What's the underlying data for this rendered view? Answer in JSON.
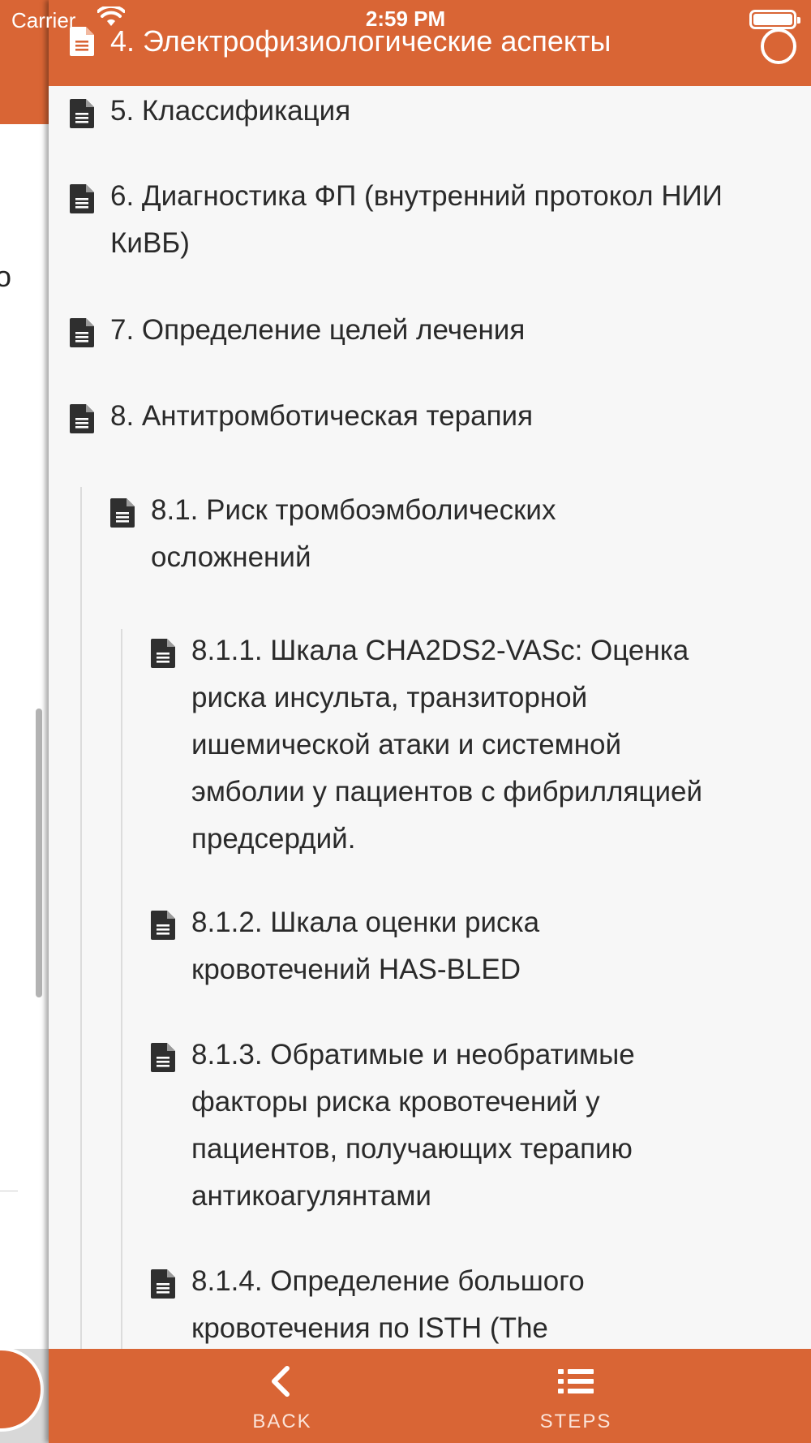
{
  "status_bar": {
    "carrier": "Carrier",
    "time": "2:59 PM"
  },
  "background": {
    "partial_glyph": "о"
  },
  "drawer": {
    "current_item": "4. Электрофизиологические аспекты",
    "items": [
      {
        "label": "5. Классификация",
        "level": 0
      },
      {
        "label": "6. Диагностика ФП (внутренний протокол НИИ КиВБ)",
        "level": 0
      },
      {
        "label": "7. Определение целей лечения",
        "level": 0
      },
      {
        "label": "8. Антитромботическая терапия",
        "level": 0
      },
      {
        "label": "8.1. Риск тромбоэмболических осложнений",
        "level": 1
      },
      {
        "label": "8.1.1. Шкала CHA2DS2-VASc: Оценка риска инсульта, транзиторной ишемической атаки и системной эмболии у пациентов с фибрилляцией предсердий.",
        "level": 2
      },
      {
        "label": "8.1.2. Шкала оценки риска кровотечений HAS-BLED",
        "level": 2
      },
      {
        "label": "8.1.3. Обратимые и необратимые факторы риска кровотечений у пациентов, получающих терапию антикоагулянтами",
        "level": 2
      },
      {
        "label": "8.1.4. Определение большого кровотечения по ISTH (The",
        "level": 2
      }
    ]
  },
  "bottom_bar": {
    "back_label": "BACK",
    "steps_label": "STEPS"
  },
  "colors": {
    "accent": "#d96535",
    "drawer_bg": "#f7f7f7",
    "text": "#2a2a2a"
  },
  "icons": {
    "item": "document-icon",
    "back": "chevron-left-icon",
    "steps": "list-icon"
  }
}
